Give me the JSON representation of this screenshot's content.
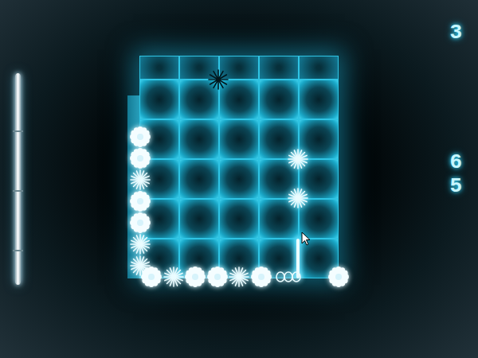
{
  "hud": {
    "score": "3",
    "counter": [
      "6",
      "5"
    ]
  },
  "beam": {
    "on": true
  },
  "pieces": [
    {
      "kind": "flower"
    },
    {
      "kind": "flower"
    },
    {
      "kind": "spark"
    },
    {
      "kind": "flower"
    },
    {
      "kind": "flower"
    },
    {
      "kind": "spark"
    },
    {
      "kind": "spark"
    },
    {
      "kind": "flower"
    },
    {
      "kind": "spark"
    },
    {
      "kind": "flower"
    },
    {
      "kind": "flower"
    },
    {
      "kind": "spark"
    },
    {
      "kind": "flower"
    },
    {
      "kind": "chain"
    },
    {
      "kind": "flower"
    },
    {
      "kind": "spark"
    },
    {
      "kind": "spark"
    },
    {
      "kind": "marker"
    }
  ]
}
